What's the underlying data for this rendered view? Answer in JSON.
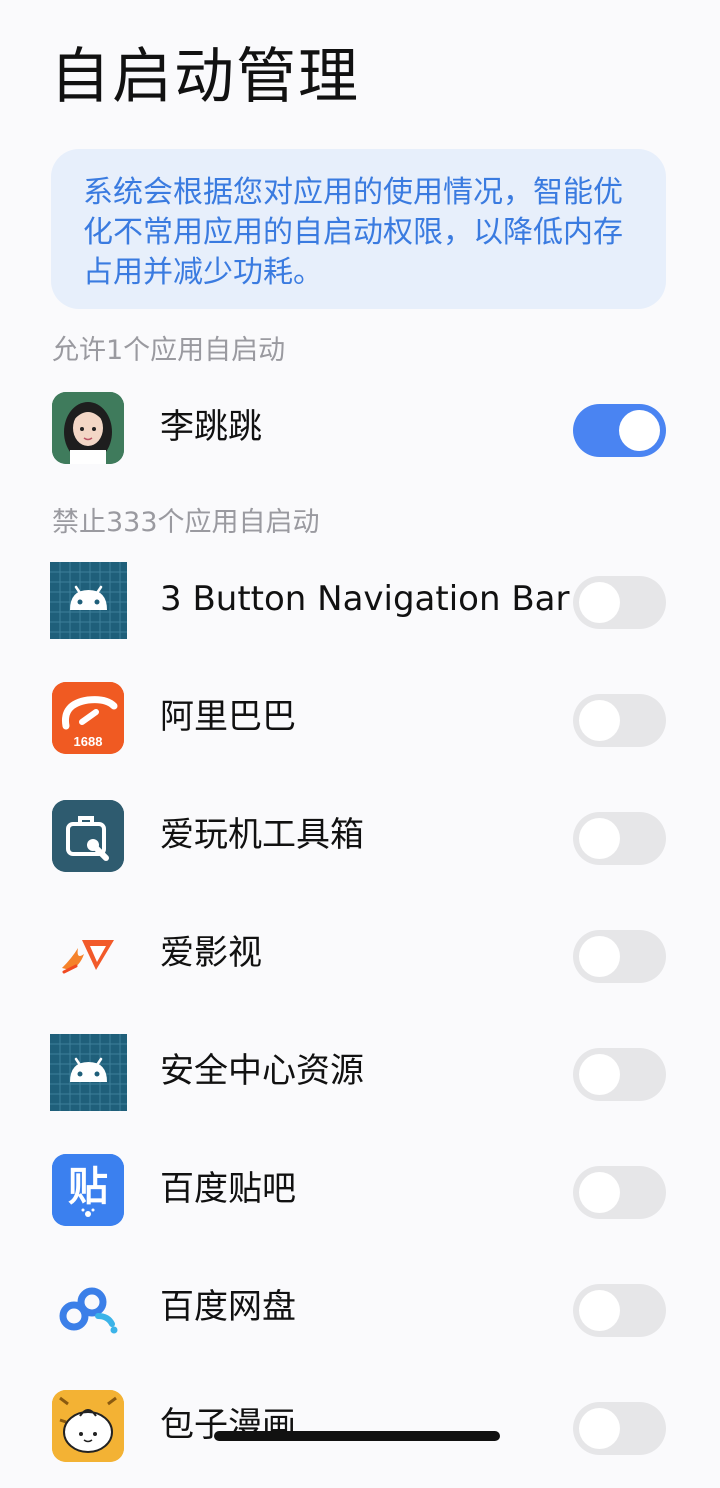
{
  "title": "自启动管理",
  "info_text": "系统会根据您对应用的使用情况，智能优化不常用应用的自启动权限，以降低内存占用并减少功耗。",
  "allowed_section": "允许1个应用自启动",
  "blocked_section": "禁止333个应用自启动",
  "accent_color": "#4a84f2",
  "apps": [
    {
      "name": "李跳跳",
      "enabled": true,
      "icon": "avatar-girl-icon"
    },
    {
      "name": "3 Button Navigation Bar",
      "enabled": false,
      "icon": "android-icon"
    },
    {
      "name": "阿里巴巴",
      "enabled": false,
      "icon": "alibaba-1688-icon",
      "icon_text": "1688"
    },
    {
      "name": "爱玩机工具箱",
      "enabled": false,
      "icon": "toolbox-icon"
    },
    {
      "name": "爱影视",
      "enabled": false,
      "icon": "play-flame-icon"
    },
    {
      "name": "安全中心资源",
      "enabled": false,
      "icon": "android-icon"
    },
    {
      "name": "百度贴吧",
      "enabled": false,
      "icon": "tieba-icon",
      "icon_text": "贴"
    },
    {
      "name": "百度网盘",
      "enabled": false,
      "icon": "baidu-netdisk-icon"
    },
    {
      "name": "包子漫画",
      "enabled": false,
      "icon": "bun-comic-icon"
    }
  ]
}
